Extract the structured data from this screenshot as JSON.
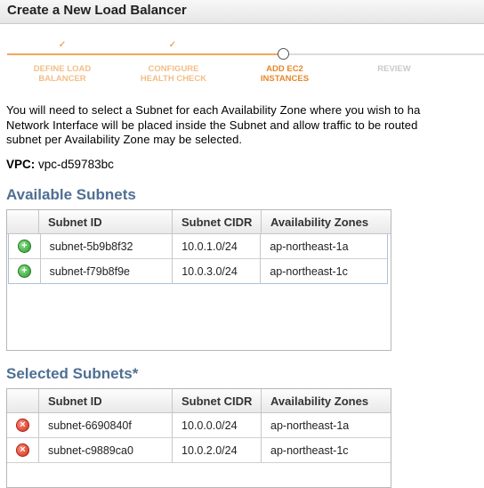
{
  "header": {
    "title": "Create a New Load Balancer"
  },
  "wizard": {
    "steps": [
      {
        "label": "DEFINE LOAD\nBALANCER",
        "state": "done"
      },
      {
        "label": "CONFIGURE\nHEALTH CHECK",
        "state": "done"
      },
      {
        "label": "ADD EC2\nINSTANCES",
        "state": "current"
      },
      {
        "label": "REVIEW",
        "state": "todo"
      }
    ]
  },
  "intro_text": "You will need to select a Subnet for each Availability Zone where you wish to ha\nNetwork Interface will be placed inside the Subnet and allow traffic to be routed\nsubnet per Availability Zone may be selected.",
  "vpc": {
    "label": "VPC:",
    "value": "vpc-d59783bc"
  },
  "available": {
    "title": "Available Subnets",
    "columns": [
      "Subnet ID",
      "Subnet CIDR",
      "Availability Zones"
    ],
    "rows": [
      {
        "id": "subnet-5b9b8f32",
        "cidr": "10.0.1.0/24",
        "zone": "ap-northeast-1a"
      },
      {
        "id": "subnet-f79b8f9e",
        "cidr": "10.0.3.0/24",
        "zone": "ap-northeast-1c"
      }
    ]
  },
  "selected": {
    "title": "Selected Subnets*",
    "columns": [
      "Subnet ID",
      "Subnet CIDR",
      "Availability Zones"
    ],
    "rows": [
      {
        "id": "subnet-6690840f",
        "cidr": "10.0.0.0/24",
        "zone": "ap-northeast-1a"
      },
      {
        "id": "subnet-c9889ca0",
        "cidr": "10.0.2.0/24",
        "zone": "ap-northeast-1c"
      }
    ]
  },
  "colors": {
    "accent": "#efa95b",
    "section_title": "#4f6f93",
    "add": "#2c9a2c",
    "remove": "#d0301d"
  },
  "icons": {
    "add": "add-circle-icon",
    "remove": "remove-circle-icon",
    "done": "checkmark-icon"
  }
}
